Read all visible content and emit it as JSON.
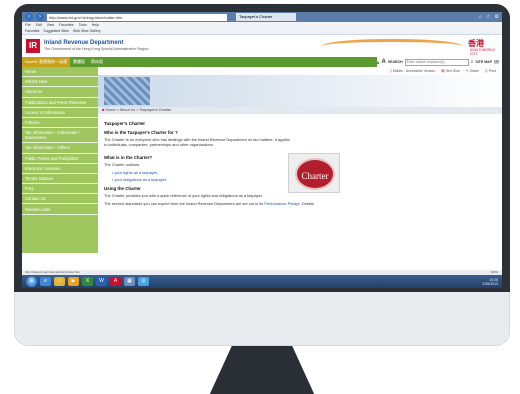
{
  "browser": {
    "address": "http://www.ird.gov.hk/eng/abo/charter.htm",
    "tab_title": "Taxpayer's Charter",
    "menu": [
      "File",
      "Edit",
      "View",
      "Favorites",
      "Tools",
      "Help"
    ],
    "favorites": [
      "Favorites",
      "Suggested Sites",
      "Web Slice Gallery"
    ]
  },
  "header": {
    "logo_letter": "IR",
    "dept_name": "Inland Revenue Department",
    "dept_sub": "The Government of the Hong Kong Special Administrative Region",
    "brand_cn": "香港",
    "brand_en": "ASIA'S WORLD CITY"
  },
  "topbar": {
    "links": [
      "GovHK 香港政府一站通",
      "繁體版",
      "简体版"
    ],
    "font_small": "A",
    "font_large": "A",
    "search_label": "SEARCH",
    "search_placeholder": "Enter search keyword(s)",
    "sitemap": "SITE MAP"
  },
  "sidebar": {
    "items": [
      "Home",
      "What's New",
      "About Us",
      "Publications and Press Releases",
      "Access to Information",
      "Policies",
      "Tax Information - Individuals / Businesses",
      "Tax Information - Others",
      "Public Forms and Pamphlets",
      "Electronic Services",
      "Tender Notices",
      "FAQ",
      "Contact Us",
      "Related Links"
    ]
  },
  "utility": {
    "mobile": "Mobile - Accessible Version",
    "textsize": "Text Size",
    "share": "Share",
    "print": "Print"
  },
  "breadcrumb": {
    "home": "Home",
    "about": "About Us",
    "current": "Taxpayer's Charter"
  },
  "article": {
    "title": "Taxpayer's Charter",
    "h_who": "Who is the Taxpayer's Charter for ?",
    "p_who": "The Charter is for everyone who has dealings with the Inland Revenue Department on tax matters. It applies to individuals, companies, partnerships and other organizations.",
    "h_what": "What is in the Charter?",
    "p_outlines": "The Charter outlines",
    "bullets": [
      "your rights as a taxpayer,",
      "your obligations as a taxpayer."
    ],
    "h_using": "Using the Charter",
    "p_using": "The Charter provides you with a quick reference of your rights and obligations as a taxpayer.",
    "p_service": "The service standards you can expect from the Inland Revenue Department are set out in its",
    "p_service_link": "Performance Pledge",
    "p_service_end": ". Details",
    "badge": "Charter"
  },
  "status": {
    "url": "http://www.ird.gov.hk/eng/abo/charter.htm",
    "zoom": "100%"
  },
  "taskbar": {
    "start": "⊞",
    "tray_time": "10:26",
    "tray_date": "2/28/2013"
  },
  "colors": {
    "green": "#5b9a2e",
    "sidebar": "#9fc65e",
    "brand_red": "#c8102e",
    "link_blue": "#1a54b0"
  }
}
